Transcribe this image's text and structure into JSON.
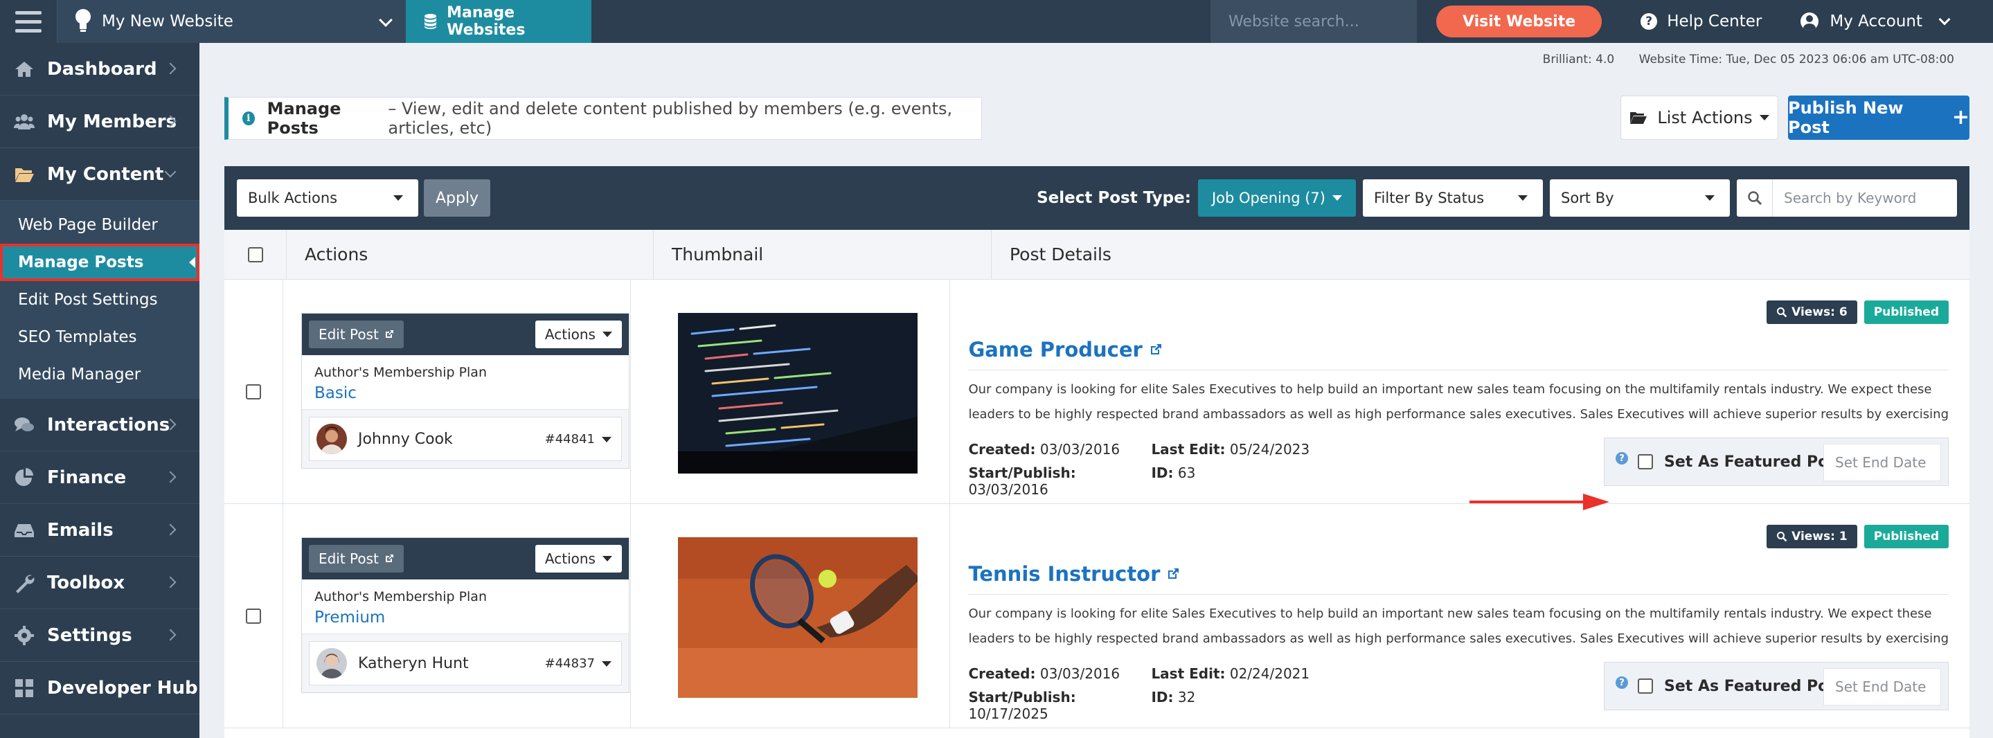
{
  "topbar": {
    "site_name": "My New Website",
    "manage_websites": "Manage Websites",
    "website_search_placeholder": "Website search...",
    "visit_website": "Visit Website",
    "help_center": "Help Center",
    "my_account": "My Account"
  },
  "sidebar": {
    "items": [
      {
        "label": "Dashboard",
        "icon": "home-icon"
      },
      {
        "label": "My Members",
        "icon": "users-icon"
      },
      {
        "label": "My Content",
        "icon": "folder-open-icon"
      }
    ],
    "content_subitems": [
      "Web Page Builder",
      "Manage Posts",
      "Edit Post Settings",
      "SEO Templates",
      "Media Manager"
    ],
    "active_subitem": "Manage Posts",
    "bottom_items": [
      {
        "label": "Interactions",
        "icon": "comments-icon"
      },
      {
        "label": "Finance",
        "icon": "pie-chart-icon"
      },
      {
        "label": "Emails",
        "icon": "inbox-icon"
      },
      {
        "label": "Toolbox",
        "icon": "wrench-icon"
      },
      {
        "label": "Settings",
        "icon": "gear-icon"
      },
      {
        "label": "Developer Hub",
        "icon": "grid-icon"
      }
    ]
  },
  "meta": {
    "version": "Brilliant: 4.0",
    "website_time": "Website Time: Tue, Dec 05 2023 06:06 am UTC-08:00"
  },
  "page": {
    "title": "Manage Posts",
    "subtitle": "– View, edit and delete content published by members (e.g. events, articles, etc)",
    "list_actions": "List Actions",
    "publish_new_post": "Publish New Post"
  },
  "toolbar": {
    "bulk_actions": "Bulk Actions",
    "apply": "Apply",
    "select_post_type_label": "Select Post Type:",
    "post_type": "Job Opening (7)",
    "filter_by_status": "Filter By Status",
    "sort_by": "Sort By",
    "keyword_placeholder": "Search by Keyword"
  },
  "table": {
    "headers": {
      "actions": "Actions",
      "thumbnail": "Thumbnail",
      "post_details": "Post Details"
    },
    "edit_post": "Edit Post",
    "actions_btn": "Actions",
    "plan_label": "Author's Membership Plan",
    "featured_label": "Set As Featured Post",
    "end_date_placeholder": "Set End Date",
    "created_label": "Created:",
    "last_edit_label": "Last Edit:",
    "start_publish_label": "Start/Publish:",
    "id_label": "ID:",
    "rows": [
      {
        "plan": "Basic",
        "member_name": "Johnny Cook",
        "member_id": "#44841",
        "title": "Game Producer",
        "views": "Views: 6",
        "status": "Published",
        "desc_line1": "Our company is looking for elite Sales Executives to help build an important new sales team focusing on the multifamily rentals industry. We expect these",
        "desc_line2": "leaders to be highly respected brand ambassadors as well as high performance sales executives. Sales Executives will achieve superior results by exercising",
        "created": "03/03/2016",
        "last_edit": "05/24/2023",
        "start_publish": "03/03/2016",
        "id": "63"
      },
      {
        "plan": "Premium",
        "member_name": "Katheryn Hunt",
        "member_id": "#44837",
        "title": "Tennis Instructor",
        "views": "Views: 1",
        "status": "Published",
        "desc_line1": "Our company is looking for elite Sales Executives to help build an important new sales team focusing on the multifamily rentals industry. We expect these",
        "desc_line2": "leaders to be highly respected brand ambassadors as well as high performance sales executives. Sales Executives will achieve superior results by exercising",
        "created": "03/03/2016",
        "last_edit": "02/24/2021",
        "start_publish": "10/17/2025",
        "id": "32"
      }
    ]
  },
  "colors": {
    "navy": "#2c3e50",
    "teal": "#1e8ca0",
    "blue": "#1b73c0",
    "coral": "#f2684e",
    "published_green": "#1aaa9a",
    "highlight_red": "#e8322a"
  }
}
